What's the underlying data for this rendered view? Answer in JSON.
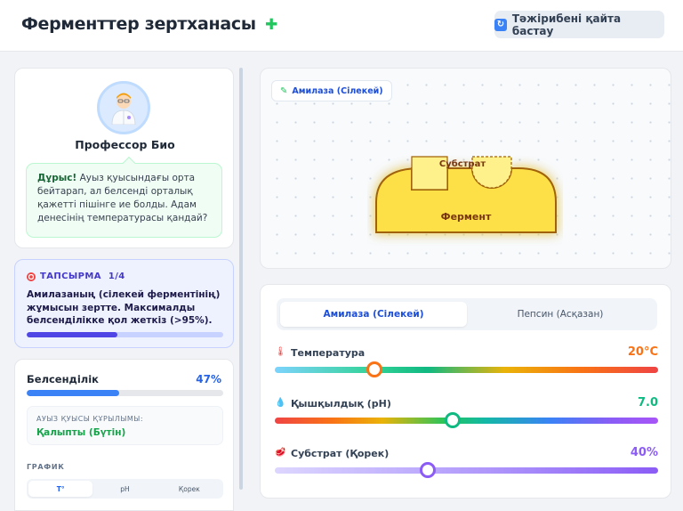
{
  "header": {
    "title": "Ферменттер зертханасы",
    "reset_label": "Тәжірибені қайта бастау"
  },
  "professor": {
    "name": "Профессор Био",
    "message_strong": "Дұрыс!",
    "message_rest": "Ауыз қуысындағы орта бейтарап, ал белсенді орталық қажетті пішінге ие болды. Адам денесінің температурасы қандай?"
  },
  "task": {
    "heading": "ТАПСЫРМА",
    "counter": "1/4",
    "text": "Амилазаның (сілекей ферментінің) жұмысын зертте. Максималды белсенділікке қол жеткіз (>95%).",
    "progress_fraction": 0.46
  },
  "stats": {
    "activity_label": "Белсенділік",
    "activity_value": "47%",
    "activity_fraction": 0.47,
    "mouth_label": "АУЫЗ ҚУЫСЫ ҚҰРЫЛЫМЫ:",
    "mouth_value": "Қалыпты (Бүтін)",
    "graph_label": "ГРАФИК",
    "graph_tabs": [
      "T°",
      "pH",
      "Қорек"
    ]
  },
  "lab": {
    "enzyme_tag": "Амилаза (Сілекей)",
    "substrate_label": "Субстрат",
    "enzyme_label": "Фермент"
  },
  "controls": {
    "tabs": [
      "Амилаза (Сілекей)",
      "Пепсин (Асқазан)"
    ],
    "sliders": [
      {
        "label": "Температура",
        "value": "20°C",
        "fraction": 0.26,
        "color": "#f97316"
      },
      {
        "label": "Қышқылдық (pH)",
        "value": "7.0",
        "fraction": 0.463,
        "color": "#10b981"
      },
      {
        "label": "Субстрат (Қорек)",
        "value": "40%",
        "fraction": 0.4,
        "color": "#8b5cf6"
      }
    ]
  },
  "colors": {
    "accent": "#3b82f6",
    "enzyme_fill": "#fde047",
    "enzyme_stroke": "#b45309",
    "success": "#16a34a"
  }
}
